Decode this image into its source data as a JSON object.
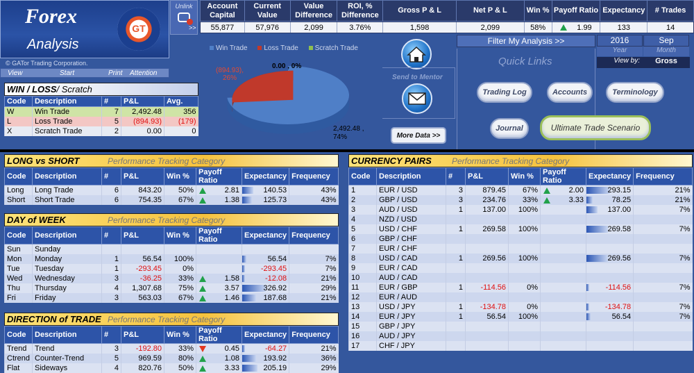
{
  "app": {
    "title_line1": "Forex",
    "title_line2": "Analysis",
    "copyright": "© GATor Trading Corporation.",
    "badge_text": "GT"
  },
  "unlink_label": "Unlink",
  "menu": {
    "view": "View",
    "start": "Start",
    "print": "Print",
    "attention": "Attention"
  },
  "summary": {
    "headers": [
      "Account Capital",
      "Current Value",
      "Value Difference",
      "ROI, % Difference",
      "Gross P & L",
      "Net P & L",
      "Win %",
      "Payoff Ratio",
      "Expectancy",
      "# Trades"
    ],
    "values": [
      "55,877",
      "57,976",
      "2,099",
      "3.76%",
      "1,598",
      "2,099",
      "58%",
      "1.99",
      "133",
      "14"
    ],
    "arrow_label": ">>"
  },
  "pie": {
    "legend": [
      "Win Trade",
      "Loss Trade",
      "Scratch Trade"
    ],
    "legend_colors": [
      "#4f7fc7",
      "#c0392b",
      "#8fbf4f"
    ],
    "slices": [
      {
        "name": "Win Trade",
        "value": 2492.48,
        "percent": 74
      },
      {
        "name": "Loss Trade",
        "value": -894.93,
        "percent": 26
      },
      {
        "name": "Scratch Trade",
        "value": 0.0,
        "percent": 0
      }
    ],
    "labels": {
      "loss": "(894.93), 26%",
      "scratch": "0.00 , 0%",
      "win": "2,492.48 , 74%"
    }
  },
  "mentor": {
    "label": "Send to Mentor"
  },
  "more_data": "More Data >>",
  "filter": {
    "title": "Filter My Analysis  >>",
    "year_value": "2016",
    "year_label": "Year",
    "month_value": "Sep",
    "month_label": "Month",
    "view_by_label": "View by:",
    "view_by_value": "Gross"
  },
  "quick_links": {
    "title": "Quick Links",
    "buttons": [
      "Trading Log",
      "Accounts",
      "Terminology",
      "Journal",
      "Ultimate Trade Scenario"
    ]
  },
  "winloss": {
    "title": "WIN / LOSS",
    "subtitle": " / Scratch",
    "headers": [
      "Code",
      "Description",
      "#",
      "P&L",
      "Avg."
    ],
    "rows": [
      {
        "code": "W",
        "desc": "Win Trade",
        "n": "7",
        "pl": "2,492.48",
        "avg": "356"
      },
      {
        "code": "L",
        "desc": "Loss Trade",
        "n": "5",
        "pl": "(894.93)",
        "avg": "(179)"
      },
      {
        "code": "X",
        "desc": "Scratch Trade",
        "n": "2",
        "pl": "0.00",
        "avg": "0"
      }
    ]
  },
  "perf_subtitle": "Performance Tracking Category",
  "long_short": {
    "title": "LONG vs SHORT",
    "headers": [
      "Code",
      "Description",
      "#",
      "P&L",
      "Win %",
      "Payoff Ratio",
      "Expectancy",
      "Frequency"
    ],
    "rows": [
      {
        "code": "Long",
        "desc": "Long Trade",
        "n": "6",
        "pl": "843.20",
        "win": "50%",
        "arrow": "up",
        "payoff": "2.81",
        "exp": "140.53",
        "exp_frac": 0.48,
        "freq": "43%"
      },
      {
        "code": "Short",
        "desc": "Short Trade",
        "n": "6",
        "pl": "754.35",
        "win": "67%",
        "arrow": "up",
        "payoff": "1.38",
        "exp": "125.73",
        "exp_frac": 0.43,
        "freq": "43%"
      }
    ]
  },
  "day_of_week": {
    "title": "DAY of WEEK",
    "headers": [
      "Code",
      "Description",
      "#",
      "P&L",
      "Win %",
      "Payoff Ratio",
      "Expectancy",
      "Frequency"
    ],
    "rows": [
      {
        "code": "Sun",
        "desc": "Sunday",
        "n": "",
        "pl": "",
        "win": "",
        "arrow": "",
        "payoff": "",
        "exp": "",
        "exp_frac": 0,
        "freq": ""
      },
      {
        "code": "Mon",
        "desc": "Monday",
        "n": "1",
        "pl": "56.54",
        "win": "100%",
        "arrow": "",
        "payoff": "",
        "exp": "56.54",
        "exp_frac": 0.19,
        "freq": "7%"
      },
      {
        "code": "Tue",
        "desc": "Tuesday",
        "n": "1",
        "pl": "-293.45",
        "win": "0%",
        "arrow": "",
        "payoff": "",
        "exp": "-293.45",
        "exp_frac": 0.0,
        "freq": "7%"
      },
      {
        "code": "Wed",
        "desc": "Wednesday",
        "n": "3",
        "pl": "-36.25",
        "win": "33%",
        "arrow": "up",
        "payoff": "1.58",
        "exp": "-12.08",
        "exp_frac": 0.0,
        "freq": "21%"
      },
      {
        "code": "Thu",
        "desc": "Thursday",
        "n": "4",
        "pl": "1,307.68",
        "win": "75%",
        "arrow": "up",
        "payoff": "3.57",
        "exp": "326.92",
        "exp_frac": 1.0,
        "freq": "29%"
      },
      {
        "code": "Fri",
        "desc": "Friday",
        "n": "3",
        "pl": "563.03",
        "win": "67%",
        "arrow": "up",
        "payoff": "1.46",
        "exp": "187.68",
        "exp_frac": 0.6,
        "freq": "21%"
      }
    ]
  },
  "direction": {
    "title": "DIRECTION of TRADE",
    "headers": [
      "Code",
      "Description",
      "#",
      "P&L",
      "Win %",
      "Payoff Ratio",
      "Expectancy",
      "Frequency"
    ],
    "rows": [
      {
        "code": "Trend",
        "desc": "Trend",
        "n": "3",
        "pl": "-192.80",
        "win": "33%",
        "arrow": "down",
        "payoff": "0.45",
        "exp": "-64.27",
        "exp_frac": 0.0,
        "freq": "21%"
      },
      {
        "code": "Ctrend",
        "desc": "Counter-Trend",
        "n": "5",
        "pl": "969.59",
        "win": "80%",
        "arrow": "up",
        "payoff": "1.08",
        "exp": "193.92",
        "exp_frac": 0.6,
        "freq": "36%"
      },
      {
        "code": "Flat",
        "desc": "Sideways",
        "n": "4",
        "pl": "820.76",
        "win": "50%",
        "arrow": "up",
        "payoff": "3.33",
        "exp": "205.19",
        "exp_frac": 0.65,
        "freq": "29%"
      }
    ]
  },
  "currency": {
    "title": "CURRENCY PAIRS",
    "headers": [
      "Code",
      "Description",
      "#",
      "P&L",
      "Win %",
      "Payoff Ratio",
      "Expectancy",
      "Frequency"
    ],
    "rows": [
      {
        "code": "1",
        "desc": "EUR / USD",
        "n": "3",
        "pl": "879.45",
        "win": "67%",
        "arrow": "up",
        "payoff": "2.00",
        "exp": "293.15",
        "exp_frac": 1.0,
        "freq": "21%"
      },
      {
        "code": "2",
        "desc": "GBP / USD",
        "n": "3",
        "pl": "234.76",
        "win": "33%",
        "arrow": "up",
        "payoff": "3.33",
        "exp": "78.25",
        "exp_frac": 0.27,
        "freq": "21%"
      },
      {
        "code": "3",
        "desc": "AUD / USD",
        "n": "1",
        "pl": "137.00",
        "win": "100%",
        "arrow": "",
        "payoff": "",
        "exp": "137.00",
        "exp_frac": 0.47,
        "freq": "7%"
      },
      {
        "code": "4",
        "desc": "NZD / USD",
        "n": "",
        "pl": "",
        "win": "",
        "arrow": "",
        "payoff": "",
        "exp": "",
        "exp_frac": 0,
        "freq": ""
      },
      {
        "code": "5",
        "desc": "USD / CHF",
        "n": "1",
        "pl": "269.58",
        "win": "100%",
        "arrow": "",
        "payoff": "",
        "exp": "269.58",
        "exp_frac": 0.92,
        "freq": "7%"
      },
      {
        "code": "6",
        "desc": "GBP / CHF",
        "n": "",
        "pl": "",
        "win": "",
        "arrow": "",
        "payoff": "",
        "exp": "",
        "exp_frac": 0,
        "freq": ""
      },
      {
        "code": "7",
        "desc": "EUR / CHF",
        "n": "",
        "pl": "",
        "win": "",
        "arrow": "",
        "payoff": "",
        "exp": "",
        "exp_frac": 0,
        "freq": ""
      },
      {
        "code": "8",
        "desc": "USD / CAD",
        "n": "1",
        "pl": "269.56",
        "win": "100%",
        "arrow": "",
        "payoff": "",
        "exp": "269.56",
        "exp_frac": 0.92,
        "freq": "7%"
      },
      {
        "code": "9",
        "desc": "EUR / CAD",
        "n": "",
        "pl": "",
        "win": "",
        "arrow": "",
        "payoff": "",
        "exp": "",
        "exp_frac": 0,
        "freq": ""
      },
      {
        "code": "10",
        "desc": "AUD / CAD",
        "n": "",
        "pl": "",
        "win": "",
        "arrow": "",
        "payoff": "",
        "exp": "",
        "exp_frac": 0,
        "freq": ""
      },
      {
        "code": "11",
        "desc": "EUR / GBP",
        "n": "1",
        "pl": "-114.56",
        "win": "0%",
        "arrow": "",
        "payoff": "",
        "exp": "-114.56",
        "exp_frac": 0.0,
        "freq": "7%"
      },
      {
        "code": "12",
        "desc": "EUR / AUD",
        "n": "",
        "pl": "",
        "win": "",
        "arrow": "",
        "payoff": "",
        "exp": "",
        "exp_frac": 0,
        "freq": ""
      },
      {
        "code": "13",
        "desc": "USD / JPY",
        "n": "1",
        "pl": "-134.78",
        "win": "0%",
        "arrow": "",
        "payoff": "",
        "exp": "-134.78",
        "exp_frac": 0.0,
        "freq": "7%"
      },
      {
        "code": "14",
        "desc": "EUR / JPY",
        "n": "1",
        "pl": "56.54",
        "win": "100%",
        "arrow": "",
        "payoff": "",
        "exp": "56.54",
        "exp_frac": 0.19,
        "freq": "7%"
      },
      {
        "code": "15",
        "desc": "GBP / JPY",
        "n": "",
        "pl": "",
        "win": "",
        "arrow": "",
        "payoff": "",
        "exp": "",
        "exp_frac": 0,
        "freq": ""
      },
      {
        "code": "16",
        "desc": "AUD / JPY",
        "n": "",
        "pl": "",
        "win": "",
        "arrow": "",
        "payoff": "",
        "exp": "",
        "exp_frac": 0,
        "freq": ""
      },
      {
        "code": "17",
        "desc": "CHF / JPY",
        "n": "",
        "pl": "",
        "win": "",
        "arrow": "",
        "payoff": "",
        "exp": "",
        "exp_frac": 0,
        "freq": ""
      }
    ]
  }
}
